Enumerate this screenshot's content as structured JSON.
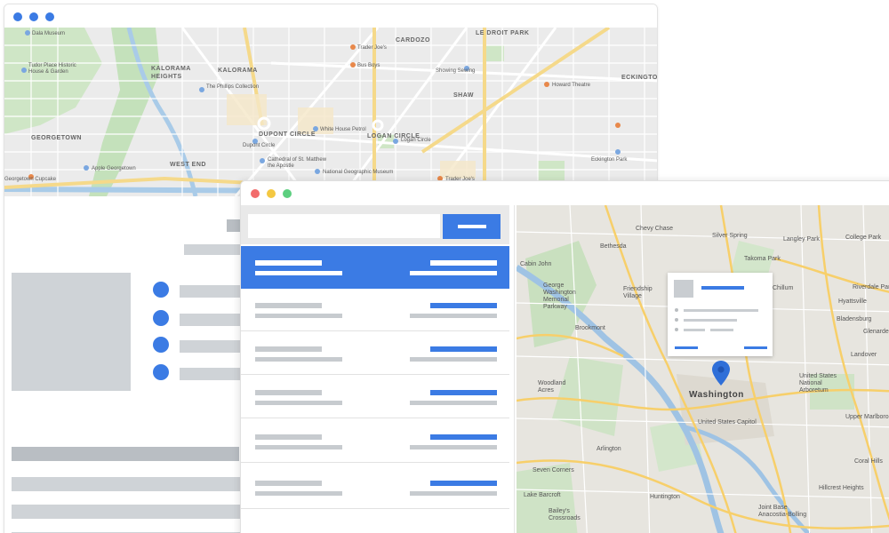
{
  "window_back": {
    "traffic_lights": [
      "#3b7be4",
      "#3b7be4",
      "#3b7be4"
    ],
    "map": {
      "neighborhood_labels": [
        "KALORAMA HEIGHTS",
        "KALORAMA",
        "DUPONT CIRCLE",
        "LOGAN CIRCLE",
        "SHAW",
        "CARDOZO",
        "GEORGETOWN",
        "WEST END",
        "ECKINGTON",
        "LE DROIT PARK"
      ],
      "poi_labels": [
        "Dala Museum",
        "Tudor Place Historic House & Garden",
        "The Phillips Collection",
        "Trader Joe's",
        "Bus Boys",
        "Showing Sewing",
        "Dupont Circle",
        "Cathedral of St. Matthew the Apostle",
        "National Geographic Museum",
        "White House Petrol",
        "Logan Circle",
        "Howard Theatre",
        "Apple Georgetown",
        "Georgetown Cupcake",
        "Trader Joe's",
        "Eckington Park"
      ]
    },
    "sidebar_dots": 4
  },
  "window_front": {
    "traffic_lights": [
      "#f26b6b",
      "#f4c842",
      "#5ccf7f"
    ],
    "search": {
      "placeholder": "",
      "button_label": ""
    },
    "results_count": 6,
    "active_result_index": 0,
    "map": {
      "city_label": "Washington",
      "labels": [
        "Bethesda",
        "Chevy Chase",
        "Silver Spring",
        "Takoma Park",
        "Langley Park",
        "College Park",
        "Riverdale Park",
        "Hyattsville",
        "Cabin John",
        "Friendship Village",
        "Brookmont",
        "Chillum",
        "Glenarden",
        "Woodland Acres",
        "Arlington",
        "Seven Corners",
        "Lake Barcroft",
        "Bailey's Crossroads",
        "Huntington",
        "Joint Base Anacostia-Bolling",
        "United States Capitol",
        "Coral Hills",
        "Hillcrest Heights",
        "George Washington Memorial Parkway",
        "Landover",
        "Bladensburg",
        "Upper Marlboro",
        "United States National Arboretum"
      ]
    }
  },
  "colors": {
    "accent": "#3b7be4",
    "placeholder": "#cfd3d7"
  }
}
